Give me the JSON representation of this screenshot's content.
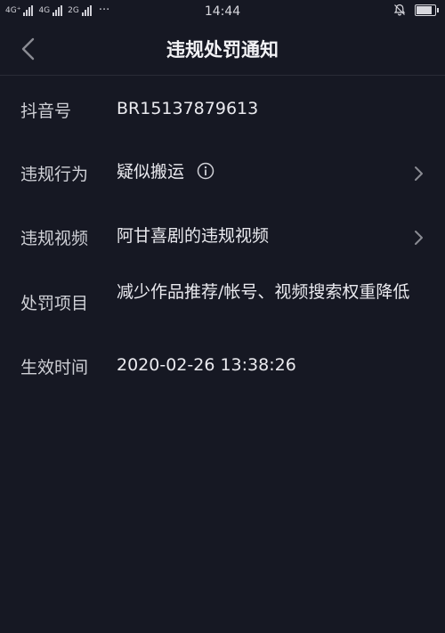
{
  "status_bar": {
    "network_1": "4G⁺",
    "network_2": "4G",
    "network_3": "2G",
    "more": "···",
    "time": "14:44"
  },
  "header": {
    "title": "违规处罚通知"
  },
  "rows": [
    {
      "label": "抖音号",
      "value": "BR15137879613"
    },
    {
      "label": "违规行为",
      "value": "疑似搬运"
    },
    {
      "label": "违规视频",
      "value": "阿甘喜剧的违规视频"
    },
    {
      "label": "处罚项目",
      "value": "减少作品推荐/帐号、视频搜索权重降低"
    },
    {
      "label": "生效时间",
      "value": "2020-02-26 13:38:26"
    }
  ],
  "icons": {
    "back": "back-arrow-icon",
    "info": "info-icon",
    "chevron": "chevron-right-icon",
    "mute": "bell-mute-icon"
  },
  "colors": {
    "background": "#161823",
    "text": "#eaeaef",
    "label": "#cfd0d6"
  },
  "battery_level": 1.0
}
